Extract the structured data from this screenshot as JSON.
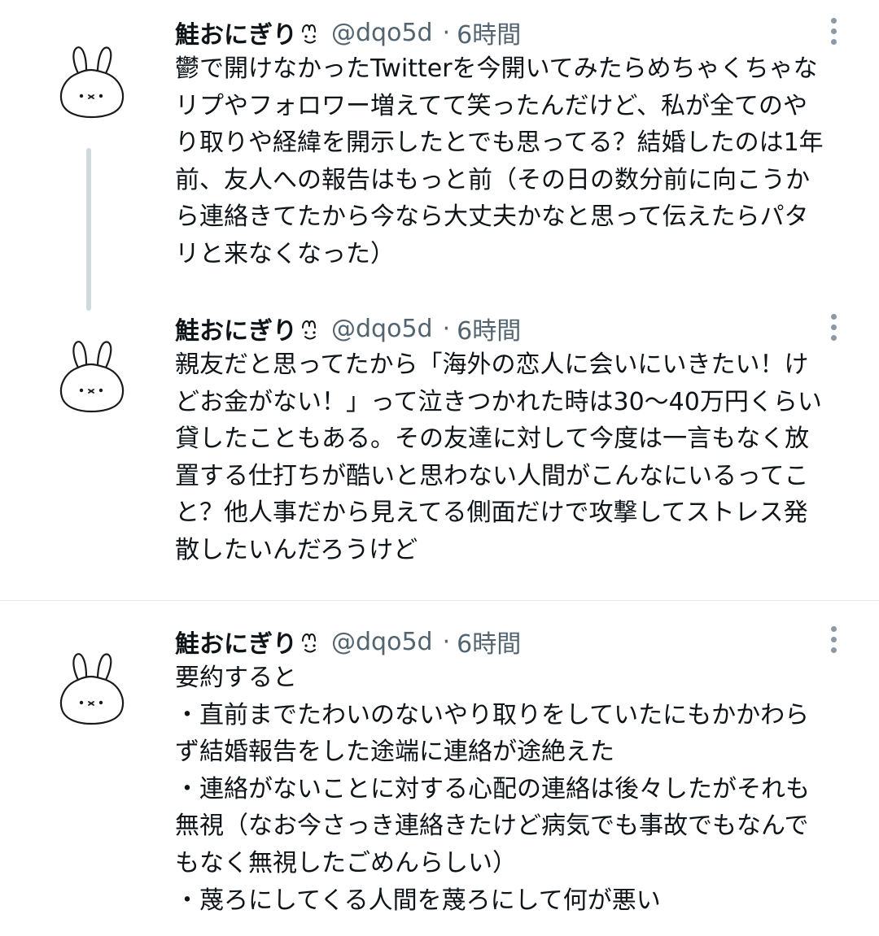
{
  "tweets": [
    {
      "name": "鮭おにぎり",
      "name_emoji": "smiley-face-emoji",
      "handle": "@dqo5d",
      "separator": "·",
      "time": "6時間",
      "lines": [
        "鬱で開けなかったTwitterを今開いてみたらめちゃくちゃな",
        "リプやフォロワー増えてて笑ったんだけど、私が全てのや",
        "り取りや経緯を開示したとでも思ってる？結婚したのは1年",
        "前、友人への報告はもっと前（その日の数分前に向こうか",
        "ら連絡きてたから今なら大丈夫かなと思って伝えたらパタ",
        "リと来なくなった）"
      ]
    },
    {
      "name": "鮭おにぎり",
      "name_emoji": "smiley-face-emoji",
      "handle": "@dqo5d",
      "separator": "·",
      "time": "6時間",
      "lines": [
        "親友だと思ってたから「海外の恋人に会いにいきたい！け",
        "どお金がない！」って泣きつかれた時は30〜40万円くらい",
        "貸したこともある。その友達に対して今度は一言もなく放",
        "置する仕打ちが酷いと思わない人間がこんなにいるってこ",
        "と？他人事だから見えてる側面だけで攻撃してストレス発",
        "散したいんだろうけど"
      ]
    },
    {
      "name": "鮭おにぎり",
      "name_emoji": "smiley-face-emoji",
      "handle": "@dqo5d",
      "separator": "·",
      "time": "6時間",
      "lines": [
        "要約すると",
        "・直前までたわいのないやり取りをしていたにもかかわら",
        "ず結婚報告をした途端に連絡が途絶えた",
        "・連絡がないことに対する心配の連絡は後々したがそれも",
        "無視（なお今さっき連絡きたけど病気でも事故でもなんで",
        "もなく無視したごめんらしい）",
        "・蔑ろにしてくる人間を蔑ろにして何が悪い"
      ]
    }
  ],
  "icons": {
    "avatar": "bunny-avatar-icon",
    "more": "more-options-icon"
  },
  "colors": {
    "text": "#0f1419",
    "secondary": "#536471",
    "thread_line": "#cfd9de",
    "divider": "#e6ecf0"
  }
}
